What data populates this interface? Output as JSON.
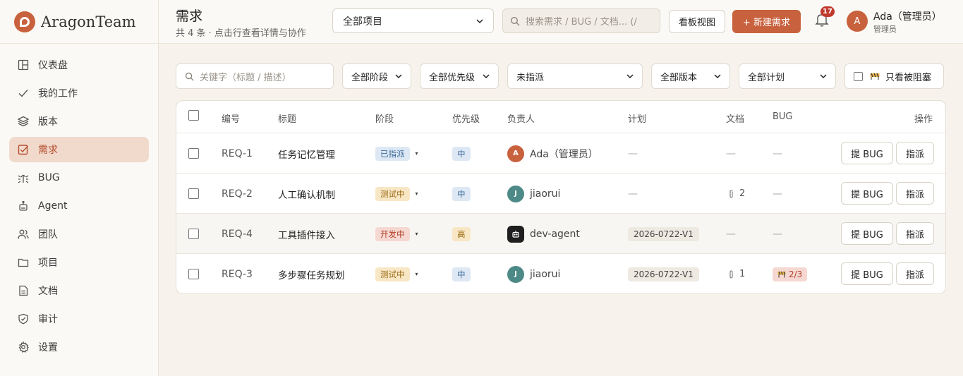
{
  "sidebar": {
    "brand": "AragonTeam",
    "items": [
      {
        "label": "仪表盘",
        "icon": "dashboard-icon"
      },
      {
        "label": "我的工作",
        "icon": "check-icon"
      },
      {
        "label": "版本",
        "icon": "layers-icon"
      },
      {
        "label": "需求",
        "icon": "edit-icon",
        "active": true
      },
      {
        "label": "BUG",
        "icon": "bug-icon"
      },
      {
        "label": "Agent",
        "icon": "robot-icon"
      },
      {
        "label": "团队",
        "icon": "team-icon"
      },
      {
        "label": "项目",
        "icon": "folder-icon"
      },
      {
        "label": "文档",
        "icon": "document-icon"
      },
      {
        "label": "审计",
        "icon": "shield-icon"
      },
      {
        "label": "设置",
        "icon": "gear-icon"
      }
    ]
  },
  "header": {
    "title": "需求",
    "subtitle": "共 4 条 · 点击行查看详情与协作",
    "project_select": "全部项目",
    "search_placeholder": "搜索需求 / BUG / 文档... (/",
    "kanban_label": "看板视图",
    "new_label": "+ 新建需求",
    "notification_count": "17",
    "user": {
      "initial": "A",
      "name": "Ada（管理员）",
      "role": "管理员"
    }
  },
  "filters": {
    "keyword_placeholder": "关键字（标题 / 描述）",
    "stage": "全部阶段",
    "priority": "全部优先级",
    "assignee": "未指派",
    "version": "全部版本",
    "plan": "全部计划",
    "blocked_label": "只看被阻塞"
  },
  "table": {
    "headers": {
      "id": "编号",
      "title": "标题",
      "stage": "阶段",
      "priority": "优先级",
      "owner": "负责人",
      "plan": "计划",
      "docs": "文档",
      "bug": "BUG",
      "action": "操作"
    },
    "rows": [
      {
        "id": "REQ-1",
        "title": "任务记忆管理",
        "stage": "已指派",
        "stage_color": "blue",
        "priority": "中",
        "owner_initial": "A",
        "owner": "Ada（管理员）",
        "owner_color": "orange",
        "plan": "—",
        "docs": "—",
        "bug": "—",
        "btn_bug": "提 BUG",
        "btn_assign": "指派"
      },
      {
        "id": "REQ-2",
        "title": "人工确认机制",
        "stage": "测试中",
        "stage_color": "yellow",
        "priority": "中",
        "owner_initial": "J",
        "owner": "jiaorui",
        "owner_color": "teal",
        "plan": "—",
        "docs": "2",
        "bug": "—",
        "btn_bug": "提 BUG",
        "btn_assign": "指派"
      },
      {
        "id": "REQ-4",
        "title": "工具插件接入",
        "stage": "开发中",
        "stage_color": "red",
        "priority": "高",
        "owner_initial": "",
        "owner": "dev-agent",
        "owner_color": "black",
        "plan": "2026-0722-V1",
        "docs": "—",
        "bug": "—",
        "btn_bug": "提 BUG",
        "btn_assign": "指派"
      },
      {
        "id": "REQ-3",
        "title": "多步骤任务规划",
        "stage": "测试中",
        "stage_color": "yellow",
        "priority": "中",
        "owner_initial": "J",
        "owner": "jiaorui",
        "owner_color": "teal",
        "plan": "2026-0722-V1",
        "docs": "1",
        "bug": "2/3",
        "btn_bug": "提 BUG",
        "btn_assign": "指派"
      }
    ]
  }
}
